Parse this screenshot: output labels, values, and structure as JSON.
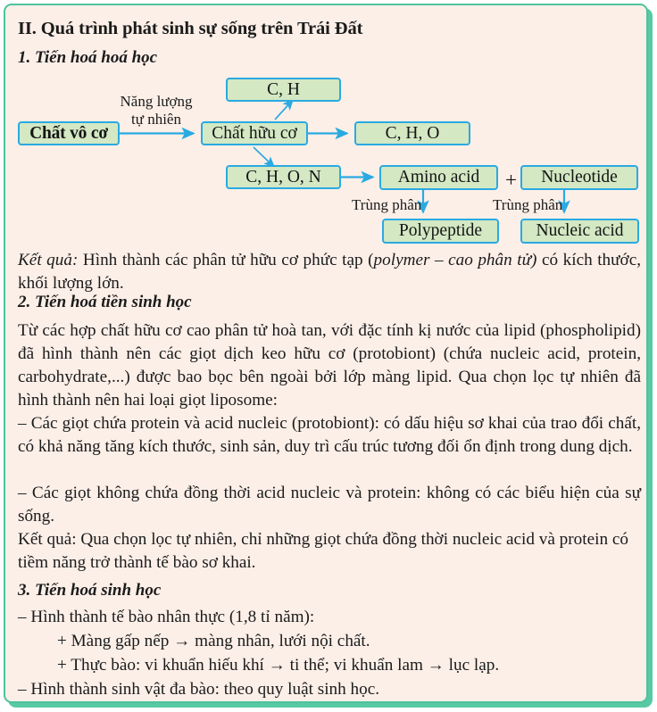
{
  "page": {
    "border_color": "#4ec39c",
    "background_color": "#fcefe8",
    "node_fill": "#d3e8c3",
    "node_border": "#2aaae1",
    "arrow_color": "#2aaae1"
  },
  "heading": {
    "main": "II. Quá trình phát sinh sự sống trên Trái Đất",
    "section1": "1. Tiến hoá hoá học",
    "section2": "2. Tiến hoá tiền sinh học",
    "section3": "3. Tiến hoá sinh học"
  },
  "diagram": {
    "nodes": {
      "inorganic": "Chất vô cơ",
      "organic": "Chất hữu cơ",
      "ch": "C, H",
      "cho": "C, H, O",
      "chon": "C, H, O, N",
      "amino_acid": "Amino acid",
      "nucleotide": "Nucleotide",
      "polypeptide": "Polypeptide",
      "nucleic_acid": "Nucleic acid"
    },
    "labels": {
      "energy_line1": "Năng lượng",
      "energy_line2": "tự nhiên",
      "polymer_left": "Trùng phân",
      "polymer_right": "Trùng phân",
      "plus": "+"
    }
  },
  "body": {
    "result1_label": "Kết quả:",
    "result1_text_a": " Hình thành các phân tử hữu cơ phức tạp (",
    "result1_italic": "polymer – cao phân tử)",
    "result1_text_b": " có kích thước, khối lượng lớn.",
    "para2": "Từ các hợp chất hữu cơ cao phân tử hoà tan, với đặc tính kị nước của lipid (phospholipid) đã hình thành nên các giọt dịch keo hữu cơ (protobiont) (chứa nucleic acid, protein, carbohydrate,...) được bao bọc bên ngoài bởi lớp màng lipid. Qua chọn lọc tự nhiên đã hình thành nên hai loại giọt liposome:",
    "bullet1": "– Các giọt chứa protein và acid nucleic (protobiont): có dấu hiệu sơ khai của trao đổi chất, có khả năng tăng kích thước, sinh sản, duy trì cấu trúc tương đối ổn định trong dung dịch.",
    "bullet2": "– Các giọt không chứa đồng thời acid nucleic và protein:  không có các biểu hiện của sự sống.",
    "result2": "Kết quả: Qua chọn lọc tự nhiên, chỉ những giọt chứa đồng thời nucleic acid và protein có tiềm năng trở thành tế bào sơ khai.",
    "s3_bullet1": "– Hình thành tế bào nhân thực (1,8 tỉ năm):",
    "s3_sub1": "+ Màng gấp nếp → màng nhân, lưới nội chất.",
    "s3_sub2": "+ Thực bào: vi khuẩn hiếu khí → ti thể; vi khuẩn lam → lục lạp.",
    "s3_bullet2": "– Hình thành sinh vật đa bào: theo quy luật sinh học."
  }
}
